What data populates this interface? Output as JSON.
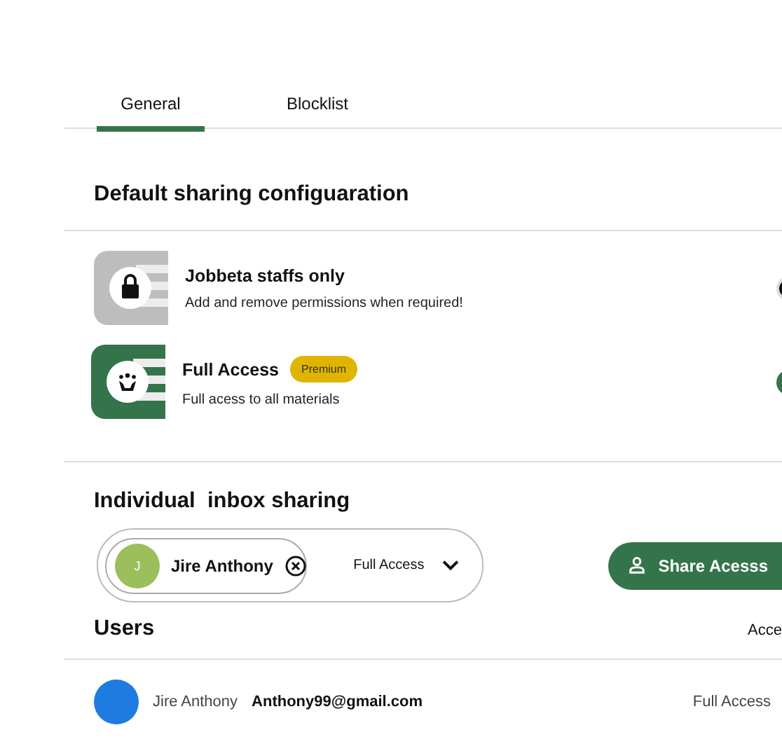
{
  "tabs": [
    {
      "label": "General",
      "selected": true
    },
    {
      "label": "Blocklist",
      "selected": false
    }
  ],
  "default_sharing": {
    "heading": "Default sharing configuaration",
    "options": [
      {
        "kind": "lock",
        "title": "Jobbeta staffs only",
        "description": "Add and remove permissions when required!",
        "on": false
      },
      {
        "kind": "team",
        "title": "Full Access",
        "badge": "Premium",
        "description": "Full acess to all materials",
        "on": true
      }
    ]
  },
  "individual_sharing": {
    "heading": "Individual  inbox sharing",
    "chip": {
      "initial": "J",
      "name": "Jire Anthony"
    },
    "access": "Full Access",
    "button": "Share Acesss"
  },
  "users": {
    "heading": "Users",
    "column_2": "Acce",
    "rows": [
      {
        "name": "Jire Anthony",
        "email": "Anthony99@gmail.com",
        "access": "Full Access"
      }
    ]
  }
}
